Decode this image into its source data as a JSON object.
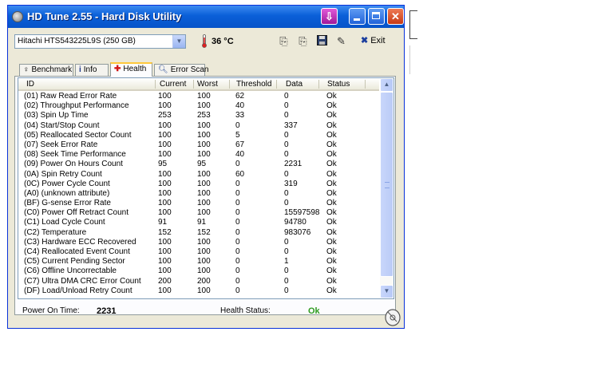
{
  "window": {
    "title": "HD Tune 2.55 - Hard Disk Utility",
    "title_icon": "hdtune-disk-icon",
    "buttons": [
      "download-icon",
      "minimize-icon",
      "maximize-icon",
      "close-icon"
    ]
  },
  "toolbar": {
    "drive": "Hitachi HTS543225L9S (250 GB)",
    "temperature": "36 °C",
    "exit_label": "Exit"
  },
  "tabs": [
    {
      "label": "Benchmark",
      "icon": "benchmark-icon"
    },
    {
      "label": "Info",
      "icon": "info-icon"
    },
    {
      "label": "Health",
      "icon": "health-cross-icon",
      "active": true
    },
    {
      "label": "Error Scan",
      "icon": "magnifier-icon"
    }
  ],
  "table": {
    "columns": [
      "ID",
      "Current",
      "Worst",
      "Threshold",
      "Data",
      "Status"
    ],
    "rows": [
      [
        "(01) Raw Read Error Rate",
        "100",
        "100",
        "62",
        "0",
        "Ok"
      ],
      [
        "(02) Throughput Performance",
        "100",
        "100",
        "40",
        "0",
        "Ok"
      ],
      [
        "(03) Spin Up Time",
        "253",
        "253",
        "33",
        "0",
        "Ok"
      ],
      [
        "(04) Start/Stop Count",
        "100",
        "100",
        "0",
        "337",
        "Ok"
      ],
      [
        "(05) Reallocated Sector Count",
        "100",
        "100",
        "5",
        "0",
        "Ok"
      ],
      [
        "(07) Seek Error Rate",
        "100",
        "100",
        "67",
        "0",
        "Ok"
      ],
      [
        "(08) Seek Time Performance",
        "100",
        "100",
        "40",
        "0",
        "Ok"
      ],
      [
        "(09) Power On Hours Count",
        "95",
        "95",
        "0",
        "2231",
        "Ok"
      ],
      [
        "(0A) Spin Retry Count",
        "100",
        "100",
        "60",
        "0",
        "Ok"
      ],
      [
        "(0C) Power Cycle Count",
        "100",
        "100",
        "0",
        "319",
        "Ok"
      ],
      [
        "(A0) (unknown attribute)",
        "100",
        "100",
        "0",
        "0",
        "Ok"
      ],
      [
        "(BF) G-sense Error Rate",
        "100",
        "100",
        "0",
        "0",
        "Ok"
      ],
      [
        "(C0) Power Off Retract Count",
        "100",
        "100",
        "0",
        "15597598",
        "Ok"
      ],
      [
        "(C1) Load Cycle Count",
        "91",
        "91",
        "0",
        "94780",
        "Ok"
      ],
      [
        "(C2) Temperature",
        "152",
        "152",
        "0",
        "983076",
        "Ok"
      ],
      [
        "(C3) Hardware ECC Recovered",
        "100",
        "100",
        "0",
        "0",
        "Ok"
      ],
      [
        "(C4) Reallocated Event Count",
        "100",
        "100",
        "0",
        "0",
        "Ok"
      ],
      [
        "(C5) Current Pending Sector",
        "100",
        "100",
        "0",
        "1",
        "Ok"
      ],
      [
        "(C6) Offline Uncorrectable",
        "100",
        "100",
        "0",
        "0",
        "Ok"
      ],
      [
        "(C7) Ultra DMA CRC Error Count",
        "200",
        "200",
        "0",
        "0",
        "Ok"
      ],
      [
        "(DF) Load/Unload Retry Count",
        "100",
        "100",
        "0",
        "0",
        "Ok"
      ]
    ]
  },
  "footer": {
    "power_on_label": "Power On Time:",
    "power_on_value": "2231",
    "health_label": "Health Status:",
    "health_value": "Ok",
    "health_color": "#2e9b1f"
  },
  "colors": {
    "titlebar": "#0a5fd8",
    "window_bg": "#ece9d8",
    "tab_highlight": "#ffc83c"
  }
}
